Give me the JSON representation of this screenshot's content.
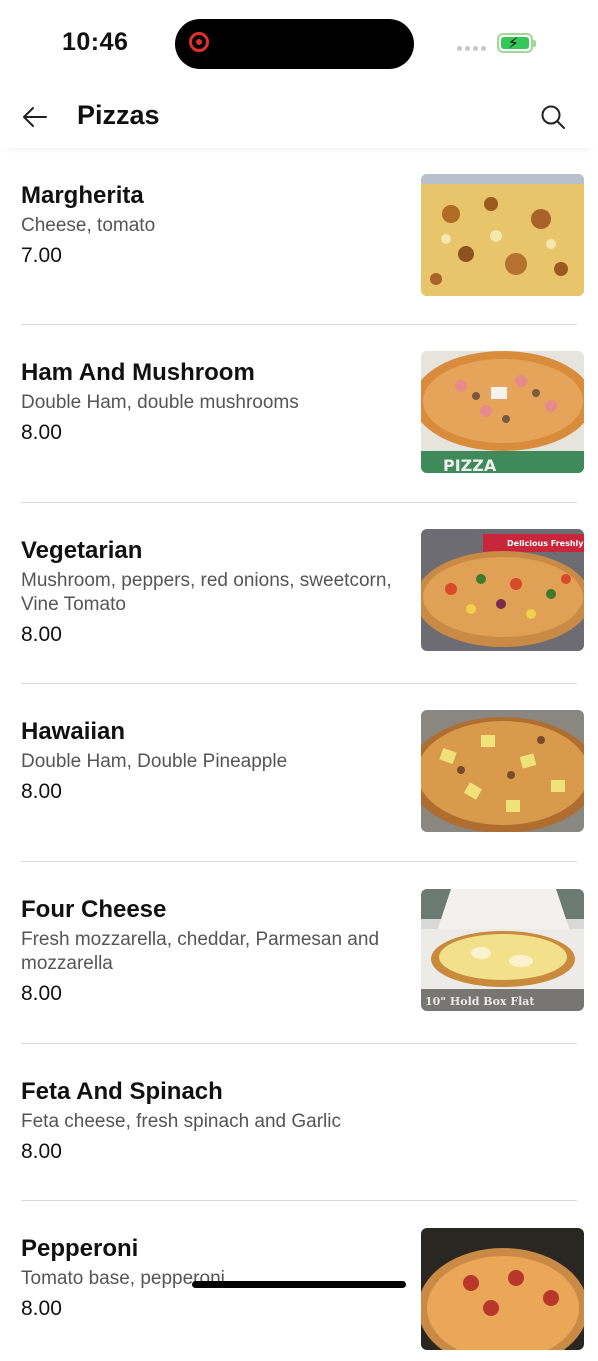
{
  "status_bar": {
    "time": "10:46"
  },
  "header": {
    "title": "Pizzas"
  },
  "items": [
    {
      "name": "Margherita",
      "description": "Cheese, tomato",
      "price": "7.00",
      "image": "pizza-margherita"
    },
    {
      "name": "Ham And Mushroom",
      "description": "Double Ham, double mushrooms",
      "price": "8.00",
      "image": "pizza-ham-mushroom"
    },
    {
      "name": "Vegetarian",
      "description": "Mushroom, peppers, red onions, sweetcorn, Vine Tomato",
      "price": "8.00",
      "image": "pizza-vegetarian"
    },
    {
      "name": "Hawaiian",
      "description": "Double Ham, Double Pineapple",
      "price": "8.00",
      "image": "pizza-hawaiian"
    },
    {
      "name": "Four Cheese",
      "description": "Fresh mozzarella, cheddar, Parmesan and mozzarella",
      "price": "8.00",
      "image": "pizza-four-cheese"
    },
    {
      "name": "Feta And Spinach",
      "description": "Feta cheese, fresh spinach and Garlic",
      "price": "8.00",
      "image": null
    },
    {
      "name": "Pepperoni",
      "description": "Tomato base, pepperoni",
      "price": "8.00",
      "image": "pizza-pepperoni"
    }
  ],
  "image_text": {
    "ham_box": "PIZZA",
    "veg_box": "Delicious Freshly Baked",
    "cheese_box": "10\" Hold Box Flat"
  }
}
